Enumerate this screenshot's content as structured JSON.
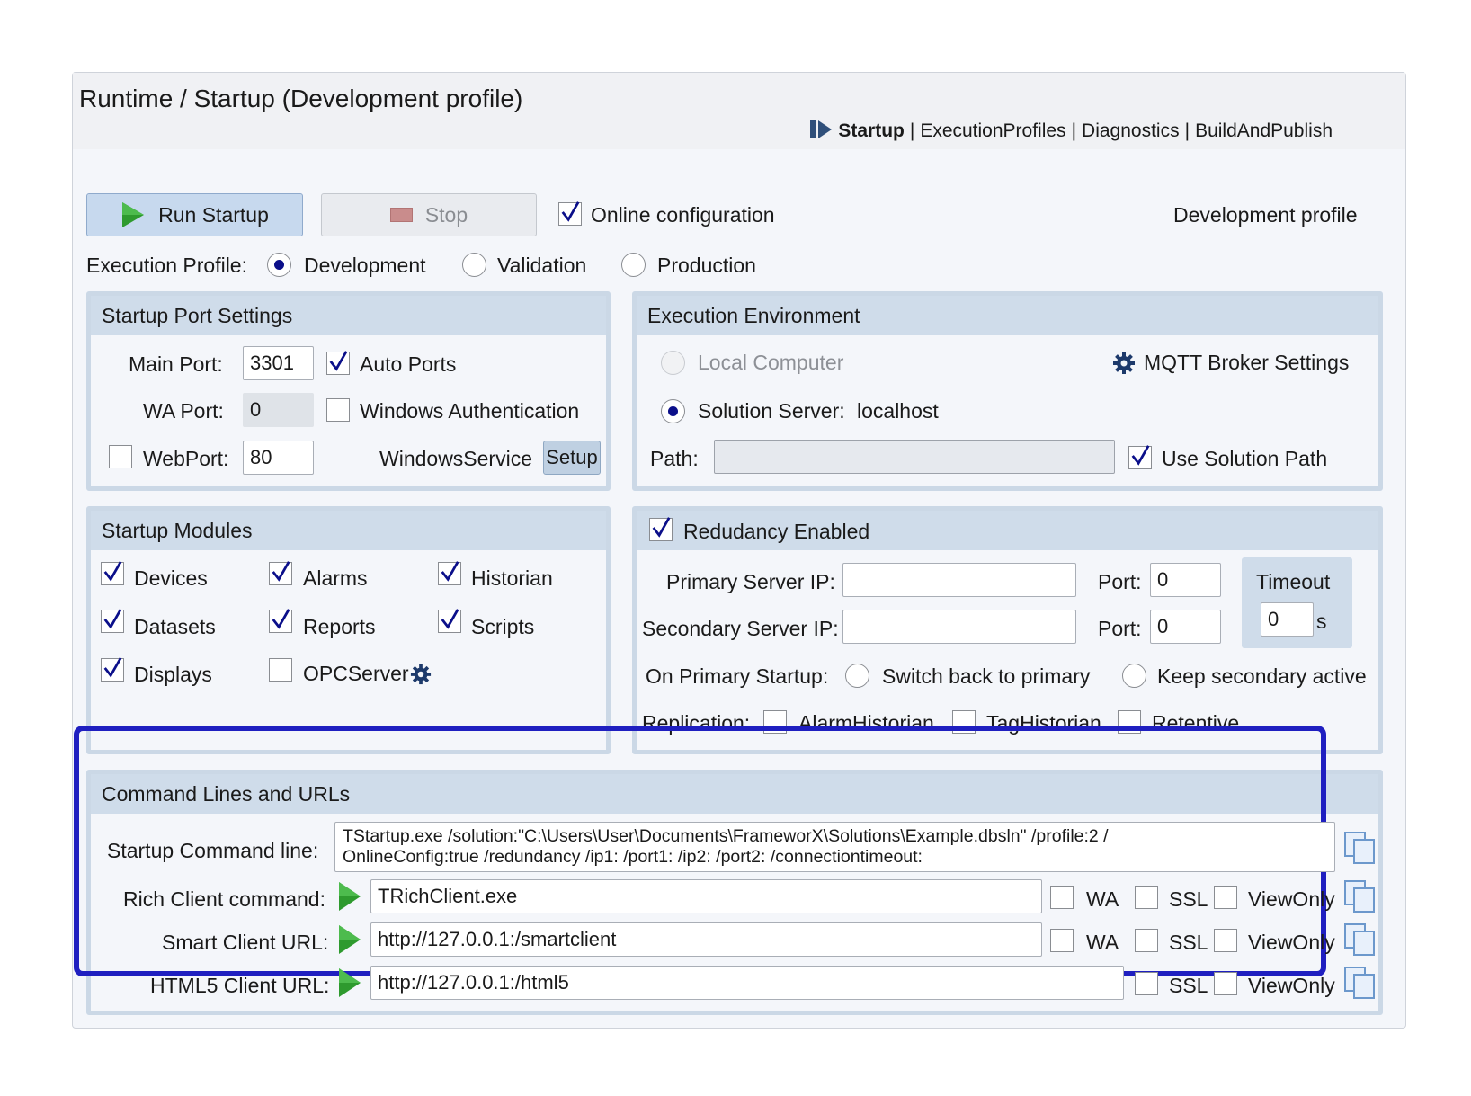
{
  "header": {
    "title": "Runtime / Startup (Development profile)",
    "breadcrumb": {
      "active": "Startup",
      "links": [
        "ExecutionProfiles",
        "Diagnostics",
        "BuildAndPublish"
      ],
      "separator": "|"
    }
  },
  "toolbar": {
    "run_label": "Run Startup",
    "stop_label": "Stop",
    "online_config_label": "Online configuration",
    "online_config_checked": true,
    "profile_label": "Development profile"
  },
  "execution_profile": {
    "label": "Execution Profile:",
    "options": [
      "Development",
      "Validation",
      "Production"
    ],
    "selected": "Development"
  },
  "port_settings": {
    "title": "Startup Port Settings",
    "main_port_label": "Main Port:",
    "main_port_value": "3301",
    "auto_ports_label": "Auto Ports",
    "auto_ports_checked": true,
    "wa_port_label": "WA Port:",
    "wa_port_value": "0",
    "windows_auth_label": "Windows Authentication",
    "windows_auth_checked": false,
    "webport_label": "WebPort:",
    "webport_value": "80",
    "webport_checked": false,
    "windows_service_label": "WindowsService",
    "setup_label": "Setup"
  },
  "execution_env": {
    "title": "Execution Environment",
    "local_computer_label": "Local Computer",
    "mqtt_label": "MQTT Broker Settings",
    "solution_server_label": "Solution Server:",
    "solution_server_value": "localhost",
    "path_label": "Path:",
    "path_value": "",
    "use_solution_path_label": "Use Solution Path",
    "use_solution_path_checked": true
  },
  "startup_modules": {
    "title": "Startup Modules",
    "items": [
      {
        "label": "Devices",
        "checked": true
      },
      {
        "label": "Alarms",
        "checked": true
      },
      {
        "label": "Historian",
        "checked": true
      },
      {
        "label": "Datasets",
        "checked": true
      },
      {
        "label": "Reports",
        "checked": true
      },
      {
        "label": "Scripts",
        "checked": true
      },
      {
        "label": "Displays",
        "checked": true
      },
      {
        "label": "OPCServer",
        "checked": false
      }
    ]
  },
  "redundancy": {
    "enabled_label": "Redudancy Enabled",
    "enabled_checked": true,
    "primary_ip_label": "Primary Server IP:",
    "primary_ip_value": "",
    "secondary_ip_label": "Secondary Server IP:",
    "secondary_ip_value": "",
    "port_label": "Port:",
    "primary_port_value": "0",
    "secondary_port_value": "0",
    "timeout_label": "Timeout",
    "timeout_value": "0",
    "timeout_unit": "s",
    "on_primary_startup_label": "On Primary Startup:",
    "switch_back_label": "Switch back to primary",
    "keep_secondary_label": "Keep secondary active",
    "replication_label": "Replication:",
    "replication_options": [
      "AlarmHistorian",
      "TagHistorian",
      "Retentive"
    ]
  },
  "command_lines": {
    "title": "Command Lines and URLs",
    "startup_label": "Startup Command line:",
    "startup_value": "TStartup.exe /solution:\"C:\\Users\\User\\Documents\\FrameworX\\Solutions\\Example.dbsln\" /profile:2 /\nOnlineConfig:true /redundancy /ip1: /port1: /ip2: /port2: /connectiontimeout:",
    "rich_label": "Rich Client command:",
    "rich_value": "TRichClient.exe",
    "smart_label": "Smart Client URL:",
    "smart_value": "http://127.0.0.1:/smartclient",
    "html5_label": "HTML5 Client URL:",
    "html5_value": "http://127.0.0.1:/html5",
    "wa_label": "WA",
    "ssl_label": "SSL",
    "viewonly_label": "ViewOnly"
  },
  "colors": {
    "accent_highlight": "#1f1fc0",
    "panel_header": "#cfdcea",
    "run_button": "#c7d9ee",
    "play_green": "#2e9a2e",
    "check_blue": "#0b0f8a"
  }
}
